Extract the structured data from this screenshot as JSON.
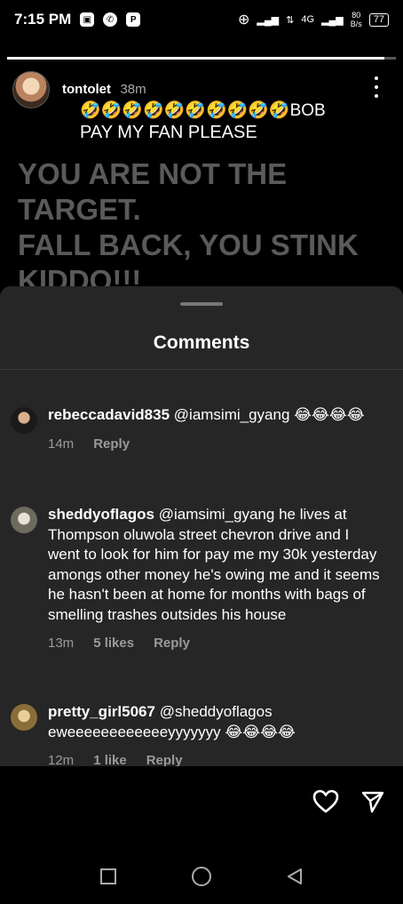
{
  "status_bar": {
    "time": "7:15 PM",
    "network_label": "4G",
    "speed_value": "80",
    "speed_unit": "B/s",
    "battery": "77"
  },
  "story": {
    "username": "tontolet",
    "time_ago": "38m",
    "caption_line1": "🤣🤣🤣🤣🤣🤣🤣🤣🤣🤣BOB",
    "caption_line2": "PAY MY FAN PLEASE",
    "big_text": "YOU ARE NOT THE TARGET.\nFALL BACK, YOU STINK\nKIDDO!!!\nTHIS IS MY LAST MESSAGE",
    "progress": 0.97
  },
  "comments_sheet": {
    "title": "Comments",
    "comments": [
      {
        "user": "rebeccadavid835",
        "text": "@iamsimi_gyang 😂😂😂😂",
        "time": "14m",
        "likes": "",
        "reply": "Reply"
      },
      {
        "user": "sheddyoflagos",
        "text": "@iamsimi_gyang he lives at Thompson oluwola street chevron drive and I went to look for him for pay me my 30k yesterday amongs other money he's owing me and it seems he hasn't been at home for months with bags of smelling trashes outsides his house",
        "time": "13m",
        "likes": "5 likes",
        "reply": "Reply"
      },
      {
        "user": "pretty_girl5067",
        "text": "@sheddyoflagos eweeeeeeeeeeeeyyyyyyy 😂😂😂😂",
        "time": "12m",
        "likes": "1 like",
        "reply": "Reply"
      }
    ]
  },
  "icons": {
    "like": "heart-icon",
    "share": "send-icon",
    "more": "more-vertical-icon"
  },
  "colors": {
    "sheet_background": "#262626",
    "screen_background": "#000000",
    "muted_text": "#9a9a9a"
  }
}
